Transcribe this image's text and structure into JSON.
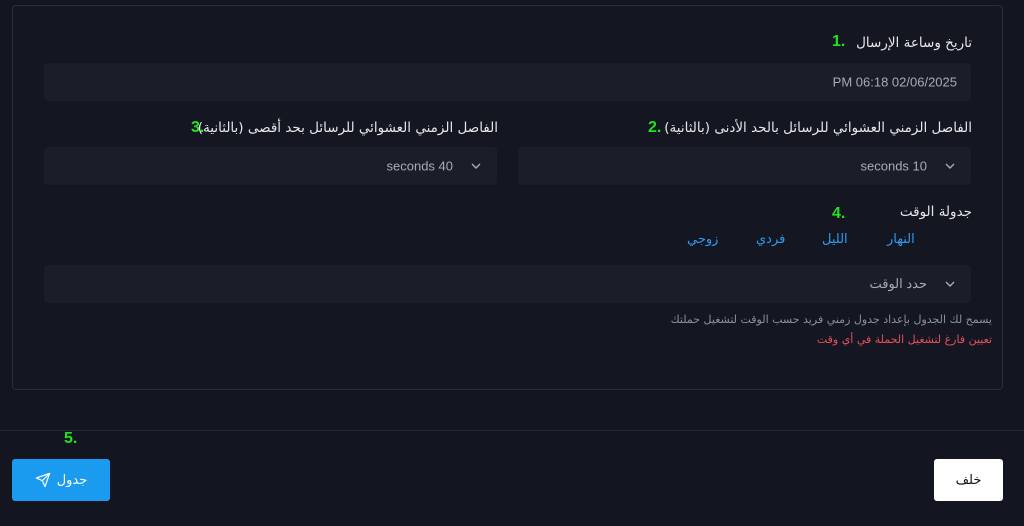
{
  "send_datetime": {
    "label": "تاريخ وساعة الإرسال",
    "step": "1.",
    "value": "PM 06:18 02/06/2025"
  },
  "min_interval": {
    "label": "الفاصل الزمني العشوائي للرسائل بالحد الأدنى (بالثانية)",
    "step": "2.",
    "value": "seconds 10"
  },
  "max_interval": {
    "label": "الفاصل الزمني العشوائي للرسائل بحد أقصى (بالثانية)",
    "step": "3.",
    "value": "seconds 40"
  },
  "time_schedule": {
    "label": "جدولة الوقت",
    "step": "4.",
    "tabs": [
      {
        "label": "النهار"
      },
      {
        "label": "الليل"
      },
      {
        "label": "فردي"
      },
      {
        "label": "زوجي"
      }
    ],
    "select_placeholder": "حدد الوقت",
    "help_text": "يسمح لك الجدول بإعداد جدول زمني فريد حسب الوقت لتشغيل حملتك",
    "help_warning": "تعيين فارغ لتشغيل الحملة في أي وقت"
  },
  "footer": {
    "step": "5.",
    "schedule_label": "جدول",
    "back_label": "خلف"
  },
  "icons": {
    "send": "send-icon",
    "chevron": "chevron-down-icon"
  },
  "colors": {
    "accent": "#1a9bf0",
    "step": "#22e31e",
    "warning": "#e8505f"
  }
}
